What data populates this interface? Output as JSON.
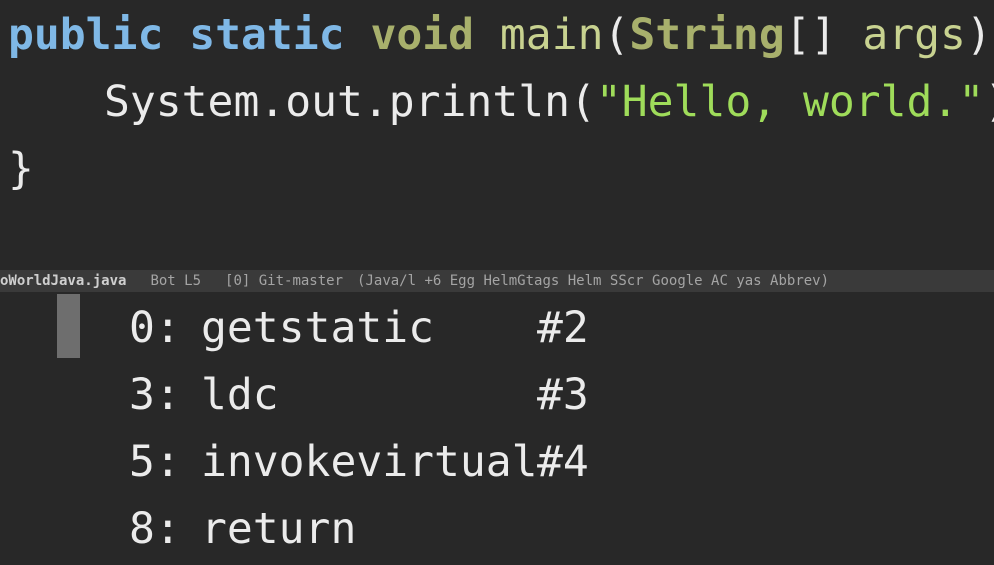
{
  "editor": {
    "code": {
      "line1": {
        "kw_public": "public",
        "kw_static": "static",
        "kw_void": "void",
        "fn_main": "main",
        "paren_open": "(",
        "type_string": "String",
        "array_brackets": "[] ",
        "arg_name": "args",
        "close": "){"
      },
      "line2": {
        "receiver": "System.out.println(",
        "string_literal": "\"Hello, world.\"",
        "terminator": ");"
      },
      "line3": {
        "brace": "}"
      }
    },
    "mode_line": {
      "buffer_name": "oWorldJava.java",
      "position": "Bot L5",
      "vcs": "[0] Git-master",
      "modes": "(Java/l +6 Egg HelmGtags Helm SScr Google AC yas Abbrev)"
    },
    "bytecode": [
      {
        "offset": "0:",
        "opcode": "getstatic",
        "operand": "#2"
      },
      {
        "offset": "3:",
        "opcode": "ldc",
        "operand": "#3"
      },
      {
        "offset": "5:",
        "opcode": "invokevirtual",
        "operand": "#4"
      },
      {
        "offset": "8:",
        "opcode": "return",
        "operand": ""
      }
    ]
  },
  "colors": {
    "background": "#282828",
    "keyword": "#7fb8e6",
    "type": "#a8b06c",
    "function": "#c8d290",
    "string": "#9fdc5a",
    "mode_line": "#3a3a3a"
  }
}
